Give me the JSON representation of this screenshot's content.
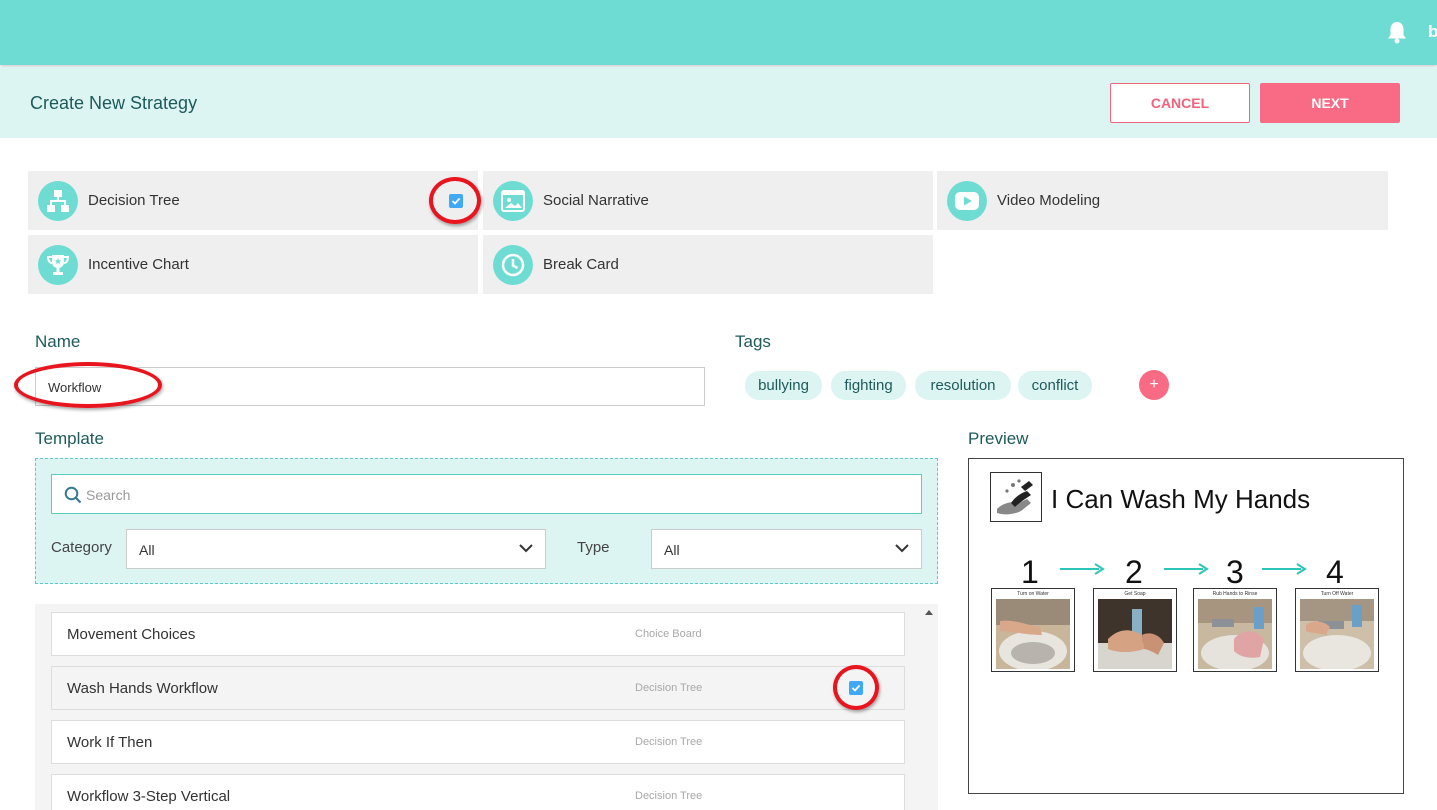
{
  "header": {
    "user_initial": "b"
  },
  "subheader": {
    "title": "Create New Strategy",
    "cancel_label": "CANCEL",
    "next_label": "NEXT"
  },
  "strategy_types": [
    {
      "label": "Decision Tree",
      "icon": "decision-tree-icon",
      "selected": true
    },
    {
      "label": "Social Narrative",
      "icon": "image-icon",
      "selected": false
    },
    {
      "label": "Video Modeling",
      "icon": "play-icon",
      "selected": false
    },
    {
      "label": "Incentive Chart",
      "icon": "trophy-icon",
      "selected": false
    },
    {
      "label": "Break Card",
      "icon": "clock-icon",
      "selected": false
    }
  ],
  "form": {
    "name_label": "Name",
    "name_value": "Workflow",
    "tags_label": "Tags",
    "tags": [
      "bullying",
      "fighting",
      "resolution",
      "conflict"
    ],
    "add_tag_glyph": "+"
  },
  "template": {
    "label": "Template",
    "search_placeholder": "Search",
    "category_label": "Category",
    "category_value": "All",
    "type_label": "Type",
    "type_value": "All",
    "items": [
      {
        "name": "Movement Choices",
        "type": "Choice Board",
        "selected": false
      },
      {
        "name": "Wash Hands Workflow",
        "type": "Decision Tree",
        "selected": true
      },
      {
        "name": "Work If Then",
        "type": "Decision Tree",
        "selected": false
      },
      {
        "name": "Workflow 3-Step Vertical",
        "type": "Decision Tree",
        "selected": false
      }
    ]
  },
  "preview": {
    "label": "Preview",
    "title": "I Can Wash My Hands",
    "steps": [
      {
        "number": "1",
        "caption": "Turn on Water"
      },
      {
        "number": "2",
        "caption": "Get Soap"
      },
      {
        "number": "3",
        "caption": "Rub Hands to Rinse"
      },
      {
        "number": "4",
        "caption": "Turn Off Water"
      }
    ]
  },
  "colors": {
    "brand_teal": "#6fdcd3",
    "light_teal": "#dcf5f3",
    "accent_pink": "#f96a84",
    "checkbox_blue": "#3fa9f5",
    "annotation_red": "#e8141e"
  }
}
